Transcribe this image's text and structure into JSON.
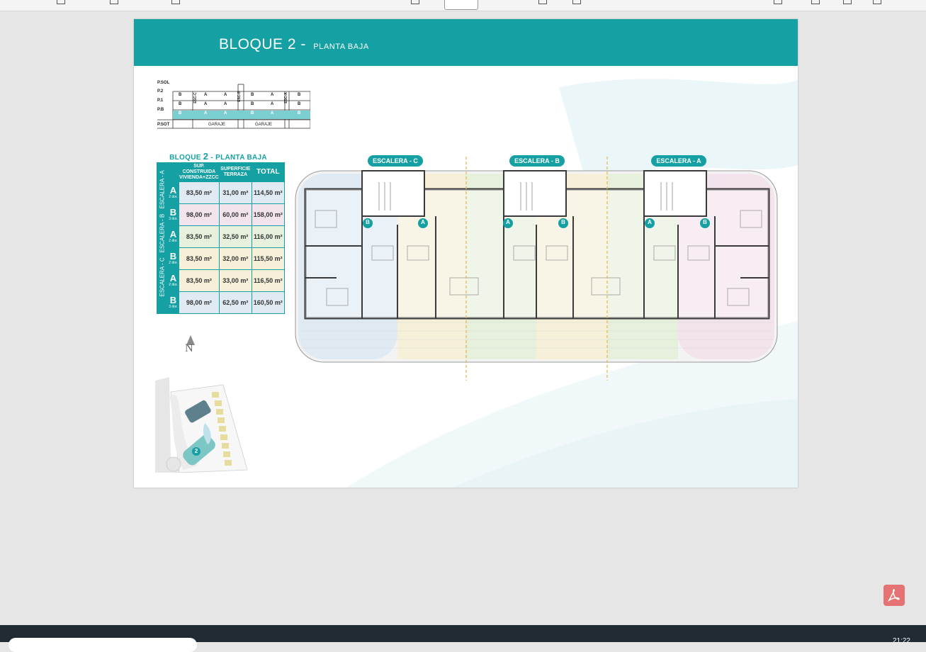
{
  "header": {
    "title_main": "BLOQUE 2 -",
    "title_sub": "PLANTA BAJA"
  },
  "section_diagram": {
    "rows": [
      "P.SOL",
      "P.2",
      "P.1",
      "P.B",
      "P.SOT"
    ],
    "p2_cells": [
      "B",
      "A",
      "A",
      "B",
      "A",
      "B"
    ],
    "p1_cells": [
      "B",
      "A",
      "A",
      "B",
      "A",
      "B"
    ],
    "pb_cells": [
      "B",
      "A",
      "A",
      "B",
      "A",
      "B"
    ],
    "stairs": [
      "ESC-C",
      "ESC-B",
      "ESC-A"
    ],
    "garage": [
      "GARAJE",
      "GARAJE"
    ]
  },
  "table": {
    "title_prefix": "BLOQUE",
    "title_num": "2",
    "title_suffix": "- PLANTA BAJA",
    "col1_line1": "SUP. CONSTRUIDA",
    "col1_line2": "VIVIENDA+ZZCC",
    "col2_line1": "SUPERFICIE",
    "col2_line2": "TERRAZA",
    "col3": "TOTAL",
    "rows": [
      {
        "escalera": "ESCALERA - A",
        "letter": "A",
        "dorm": "2 dor.",
        "construida": "83,50 m²",
        "terraza": "31,00 m²",
        "total": "114,50 m²"
      },
      {
        "escalera": "",
        "letter": "B",
        "dorm": "3 dor.",
        "construida": "98,00 m²",
        "terraza": "60,00 m²",
        "total": "158,00 m²"
      },
      {
        "escalera": "ESCALERA - B",
        "letter": "A",
        "dorm": "2 dor.",
        "construida": "83,50 m²",
        "terraza": "32,50 m²",
        "total": "116,00 m²"
      },
      {
        "escalera": "",
        "letter": "B",
        "dorm": "2 dor.",
        "construida": "83,50 m²",
        "terraza": "32,00 m²",
        "total": "115,50 m²"
      },
      {
        "escalera": "ESCALERA - C",
        "letter": "A",
        "dorm": "2 dor.",
        "construida": "83,50 m²",
        "terraza": "33,00 m²",
        "total": "116,50 m²"
      },
      {
        "escalera": "",
        "letter": "B",
        "dorm": "3 dor.",
        "construida": "98,00 m²",
        "terraza": "62,50 m²",
        "total": "160,50 m²"
      }
    ]
  },
  "plan": {
    "stair_labels": [
      "ESCALERA - C",
      "ESCALERA - B",
      "ESCALERA - A"
    ],
    "unit_badges": [
      "B",
      "A",
      "A",
      "B",
      "A",
      "B"
    ]
  },
  "site": {
    "north": "N",
    "block_badge": "2"
  },
  "taskbar": {
    "clock": "21:22"
  },
  "colors": {
    "teal": "#15a0a3",
    "unit_blue": "#dfeaf3",
    "unit_yellow": "#f6f0d9",
    "unit_green": "#e6f0dc",
    "unit_pink": "#f3e3ec"
  }
}
